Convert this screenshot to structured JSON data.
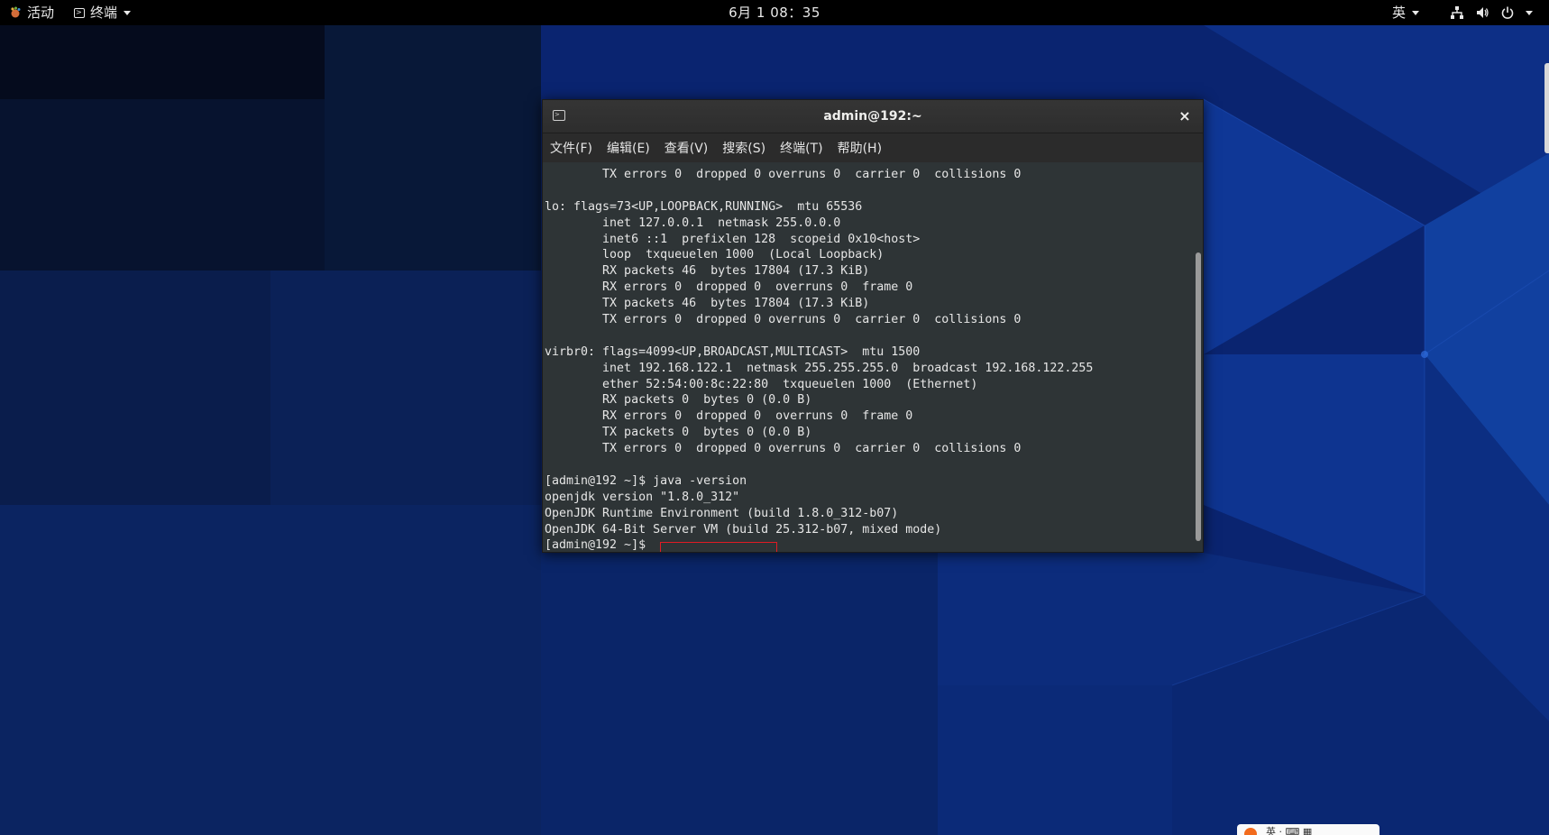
{
  "topbar": {
    "activities_label": "活动",
    "app_menu_label": "终端",
    "clock": "6月 1  08：35",
    "ime_label": "英",
    "icons": [
      "network-icon",
      "volume-icon",
      "power-icon",
      "chevron-down-icon"
    ]
  },
  "terminal": {
    "title": "admin@192:~",
    "close_glyph": "×",
    "menu": [
      {
        "label": "文件(F)"
      },
      {
        "label": "编辑(E)"
      },
      {
        "label": "查看(V)"
      },
      {
        "label": "搜索(S)"
      },
      {
        "label": "终端(T)"
      },
      {
        "label": "帮助(H)"
      }
    ],
    "lines": [
      "        TX errors 0  dropped 0 overruns 0  carrier 0  collisions 0",
      "",
      "lo: flags=73<UP,LOOPBACK,RUNNING>  mtu 65536",
      "        inet 127.0.0.1  netmask 255.0.0.0",
      "        inet6 ::1  prefixlen 128  scopeid 0x10<host>",
      "        loop  txqueuelen 1000  (Local Loopback)",
      "        RX packets 46  bytes 17804 (17.3 KiB)",
      "        RX errors 0  dropped 0  overruns 0  frame 0",
      "        TX packets 46  bytes 17804 (17.3 KiB)",
      "        TX errors 0  dropped 0 overruns 0  carrier 0  collisions 0",
      "",
      "virbr0: flags=4099<UP,BROADCAST,MULTICAST>  mtu 1500",
      "        inet 192.168.122.1  netmask 255.255.255.0  broadcast 192.168.122.255",
      "        ether 52:54:00:8c:22:80  txqueuelen 1000  (Ethernet)",
      "        RX packets 0  bytes 0 (0.0 B)",
      "        RX errors 0  dropped 0  overruns 0  frame 0",
      "        TX packets 0  bytes 0 (0.0 B)",
      "        TX errors 0  dropped 0 overruns 0  carrier 0  collisions 0",
      "",
      "[admin@192 ~]$ java -version",
      "openjdk version \"1.8.0_312\"",
      "OpenJDK Runtime Environment (build 1.8.0_312-b07)",
      "OpenJDK 64-Bit Server VM (build 25.312-b07, mixed mode)",
      "[admin@192 ~]$ "
    ]
  },
  "tray_popup": {
    "text": "英  ·  ⌨  ▦"
  },
  "colors": {
    "terminal_bg": "#2e3436",
    "terminal_fg": "#e6e6e6",
    "highlight_border": "#e01b24",
    "topbar_bg": "#000000",
    "desktop_bg": "#0c2a7a"
  }
}
